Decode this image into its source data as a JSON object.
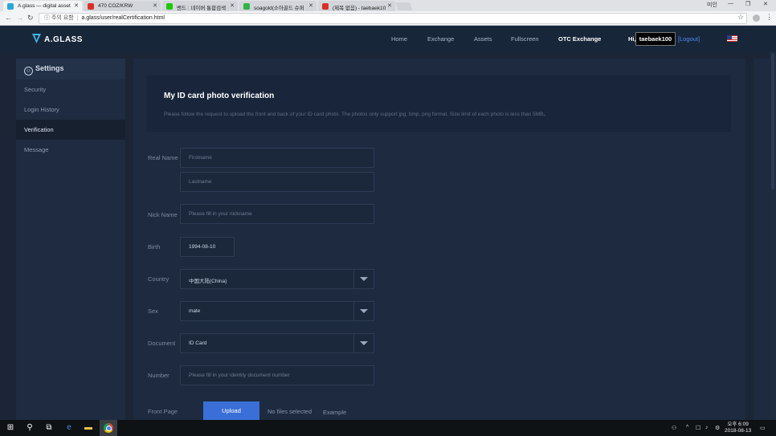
{
  "browser": {
    "tabs": [
      {
        "label": "A.glass — digital asset",
        "favicon_color": "#2aa6d9",
        "active": true
      },
      {
        "label": "470 COZ/KRW",
        "favicon_color": "#d93025",
        "active": false
      },
      {
        "label": "밴드 : 네이버 통합검색",
        "favicon_color": "#1ec800",
        "active": false
      },
      {
        "label": "soagold(소아골드 슈퍼",
        "favicon_color": "#30b34a",
        "active": false
      },
      {
        "label": "(제목 없음) - taebaek10",
        "favicon_color": "#d93025",
        "active": false
      }
    ],
    "window_user": "미인",
    "secure_label": "주의 요함",
    "url": "a.glass/user/realCertification.html"
  },
  "header": {
    "logo": "A.GLASS",
    "nav": [
      "Home",
      "Exchange",
      "Assets",
      "Fullscreen",
      "OTC Exchange"
    ],
    "greeting": "Hi,",
    "username": "taebaek100",
    "logout": "[Logout]"
  },
  "sidebar": {
    "title": "Settings",
    "items": [
      "Security",
      "Login History",
      "Verification",
      "Message"
    ],
    "active_index": 2
  },
  "verification": {
    "title": "My ID card photo verification",
    "description": "Please follow the request to upload the front and back of your ID card photo. The photos only support jpg, bmp, png format. Size limit of each photo is less than 5MB。"
  },
  "form": {
    "real_name_label": "Real Name",
    "firstname_placeholder": "Firstname",
    "lastname_placeholder": "Lastname",
    "nick_name_label": "Nick Name",
    "nickname_placeholder": "Please fill in your nickname",
    "birth_label": "Birth",
    "birth_value": "1994-08-10",
    "country_label": "Country",
    "country_value": "中国大陆(China)",
    "sex_label": "Sex",
    "sex_value": "male",
    "document_label": "Document",
    "document_value": "ID Card",
    "number_label": "Number",
    "number_placeholder": "Please fill in your identity document number",
    "front_page_label": "Front Page",
    "upload_label": "Upload",
    "no_files": "No files selected",
    "example": "Example"
  },
  "taskbar": {
    "time_period": "오후 6:09",
    "date": "2018-08-13"
  }
}
